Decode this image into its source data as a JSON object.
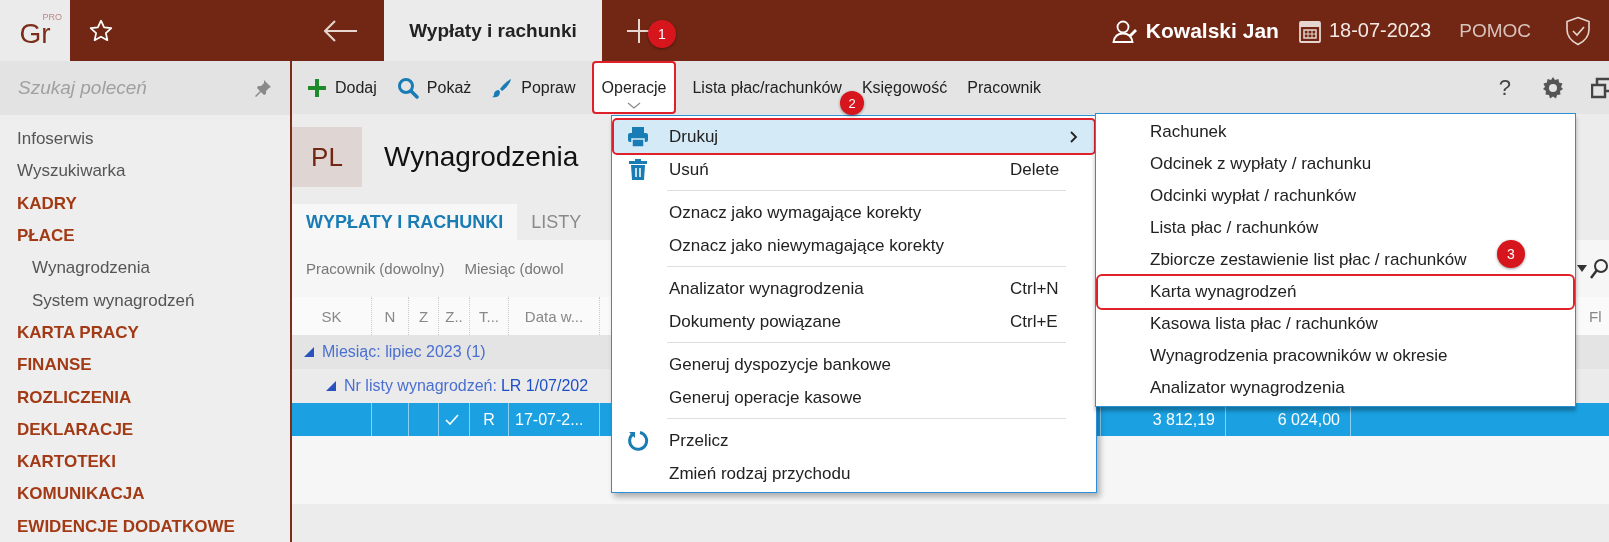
{
  "topbar": {
    "logo": "Gr",
    "logo_badge": "PRO",
    "tabs": [
      {
        "label": "Wypłaty i rachunki",
        "selected": true
      }
    ],
    "user": "Kowalski Jan",
    "date": "18-07-2023",
    "help": "POMOC"
  },
  "sidebar": {
    "search": {
      "placeholder": "Szukaj poleceń"
    },
    "items": [
      {
        "label": "Infoserwis",
        "kind": "link"
      },
      {
        "label": "Wyszukiwarka",
        "kind": "link"
      },
      {
        "label": "KADRY",
        "kind": "section"
      },
      {
        "label": "PŁACE",
        "kind": "section",
        "children": [
          {
            "label": "Wynagrodzenia"
          },
          {
            "label": "System wynagrodzeń"
          }
        ]
      },
      {
        "label": "KARTA PRACY",
        "kind": "section"
      },
      {
        "label": "FINANSE",
        "kind": "section"
      },
      {
        "label": "ROZLICZENIA",
        "kind": "section"
      },
      {
        "label": "DEKLARACJE",
        "kind": "section"
      },
      {
        "label": "KARTOTEKI",
        "kind": "section"
      },
      {
        "label": "KOMUNIKACJA",
        "kind": "section"
      },
      {
        "label": "EWIDENCJE DODATKOWE",
        "kind": "section"
      }
    ]
  },
  "toolbar": {
    "buttons": [
      {
        "label": "Dodaj",
        "highlighted": false
      },
      {
        "label": "Pokaż",
        "highlighted": false
      },
      {
        "label": "Popraw",
        "highlighted": false
      },
      {
        "label": "Operacje",
        "highlighted": true,
        "badge": "1"
      },
      {
        "label": "Lista płac/rachunków",
        "highlighted": false
      },
      {
        "label": "Księgowość",
        "highlighted": false
      },
      {
        "label": "Pracownik",
        "highlighted": false
      }
    ],
    "help_symbol": "?"
  },
  "page": {
    "badge": "PL",
    "title": "Wynagrodzenia"
  },
  "tabs": [
    {
      "label": "WYPŁATY I RACHUNKI",
      "selected": true
    },
    {
      "label": "LISTY",
      "selected": false
    }
  ],
  "filters": [
    "Pracownik (dowolny)",
    "Miesiąc (dowol"
  ],
  "grid": {
    "columns": [
      "SK",
      "N",
      "Z",
      "Z..",
      "T...",
      "Data w..."
    ],
    "last_column": "Fl",
    "groups": [
      {
        "label": "Miesiąc: lipiec 2023 (1)",
        "expanded": true,
        "children": [
          {
            "label": "Nr listy wynagrodzeń:",
            "value": "LR 1/07/202",
            "expanded": true,
            "rows": [
              {
                "selected": true,
                "checked": true,
                "type": "R",
                "date": "17-07-2...",
                "amounts": [
                  "3 812,19",
                  "6 024,00"
                ]
              }
            ]
          }
        ]
      }
    ]
  },
  "menu": {
    "sections": [
      [
        {
          "label": "Drukuj",
          "submenu": true,
          "selected": true,
          "highlighted": true,
          "badge": "2"
        },
        {
          "label": "Usuń",
          "shortcut": "Delete",
          "submenu": false,
          "selected": false,
          "highlighted": false
        }
      ],
      [
        {
          "label": "Oznacz jako wymagające korekty",
          "submenu": false,
          "selected": false,
          "highlighted": false
        },
        {
          "label": "Oznacz jako niewymagające korekty",
          "submenu": false,
          "selected": false,
          "highlighted": false
        }
      ],
      [
        {
          "label": "Analizator wynagrodzenia",
          "shortcut": "Ctrl+N",
          "submenu": false,
          "selected": false,
          "highlighted": false
        },
        {
          "label": "Dokumenty powiązane",
          "shortcut": "Ctrl+E",
          "submenu": false,
          "selected": false,
          "highlighted": false
        }
      ],
      [
        {
          "label": "Generuj dyspozycje bankowe",
          "submenu": false,
          "selected": false,
          "highlighted": false
        },
        {
          "label": "Generuj operacje kasowe",
          "submenu": false,
          "selected": false,
          "highlighted": false
        }
      ],
      [
        {
          "label": "Przelicz",
          "submenu": false,
          "selected": false,
          "highlighted": false
        },
        {
          "label": "Zmień rodzaj przychodu",
          "submenu": false,
          "selected": false,
          "highlighted": false
        }
      ]
    ]
  },
  "submenu": {
    "items": [
      {
        "label": "Rachunek",
        "highlighted": false
      },
      {
        "label": "Odcinek z wypłaty / rachunku",
        "highlighted": false
      },
      {
        "label": "Odcinki wypłat / rachunków",
        "highlighted": false
      },
      {
        "label": "Lista płac / rachunków",
        "highlighted": false
      },
      {
        "label": "Zbiorcze zestawienie list płac / rachunków",
        "highlighted": false
      },
      {
        "label": "Karta wynagrodzeń",
        "highlighted": true,
        "badge": "3"
      },
      {
        "label": "Kasowa lista płac / rachunków",
        "highlighted": false
      },
      {
        "label": "Wynagrodzenia pracowników w okresie",
        "highlighted": false
      },
      {
        "label": "Analizator wynagrodzenia",
        "highlighted": false
      }
    ]
  }
}
